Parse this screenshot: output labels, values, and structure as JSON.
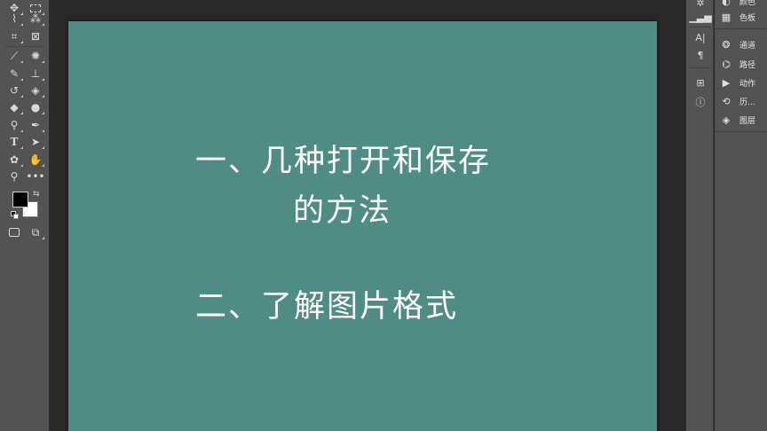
{
  "canvas": {
    "background": "#4f8c83",
    "line1": "一、几种打开和保存",
    "line2": "的方法",
    "line3": "二、了解图片格式"
  },
  "panels": {
    "top_partial_label": "颜色",
    "items": [
      {
        "icon": "swatches-icon",
        "label": "色板"
      },
      {
        "icon": "channels-icon",
        "label": "通道"
      },
      {
        "icon": "paths-icon",
        "label": "路径"
      },
      {
        "icon": "actions-icon",
        "label": "动作"
      },
      {
        "icon": "history-icon",
        "label": "历..."
      },
      {
        "icon": "layers-icon",
        "label": "图层"
      }
    ]
  },
  "icon_strip": {
    "character_glyph": "A|",
    "paragraph_glyph": "¶"
  },
  "colors": {
    "foreground": "#000000",
    "background": "#ffffff",
    "panel_bg": "#535353",
    "workspace_bg": "#282828"
  }
}
